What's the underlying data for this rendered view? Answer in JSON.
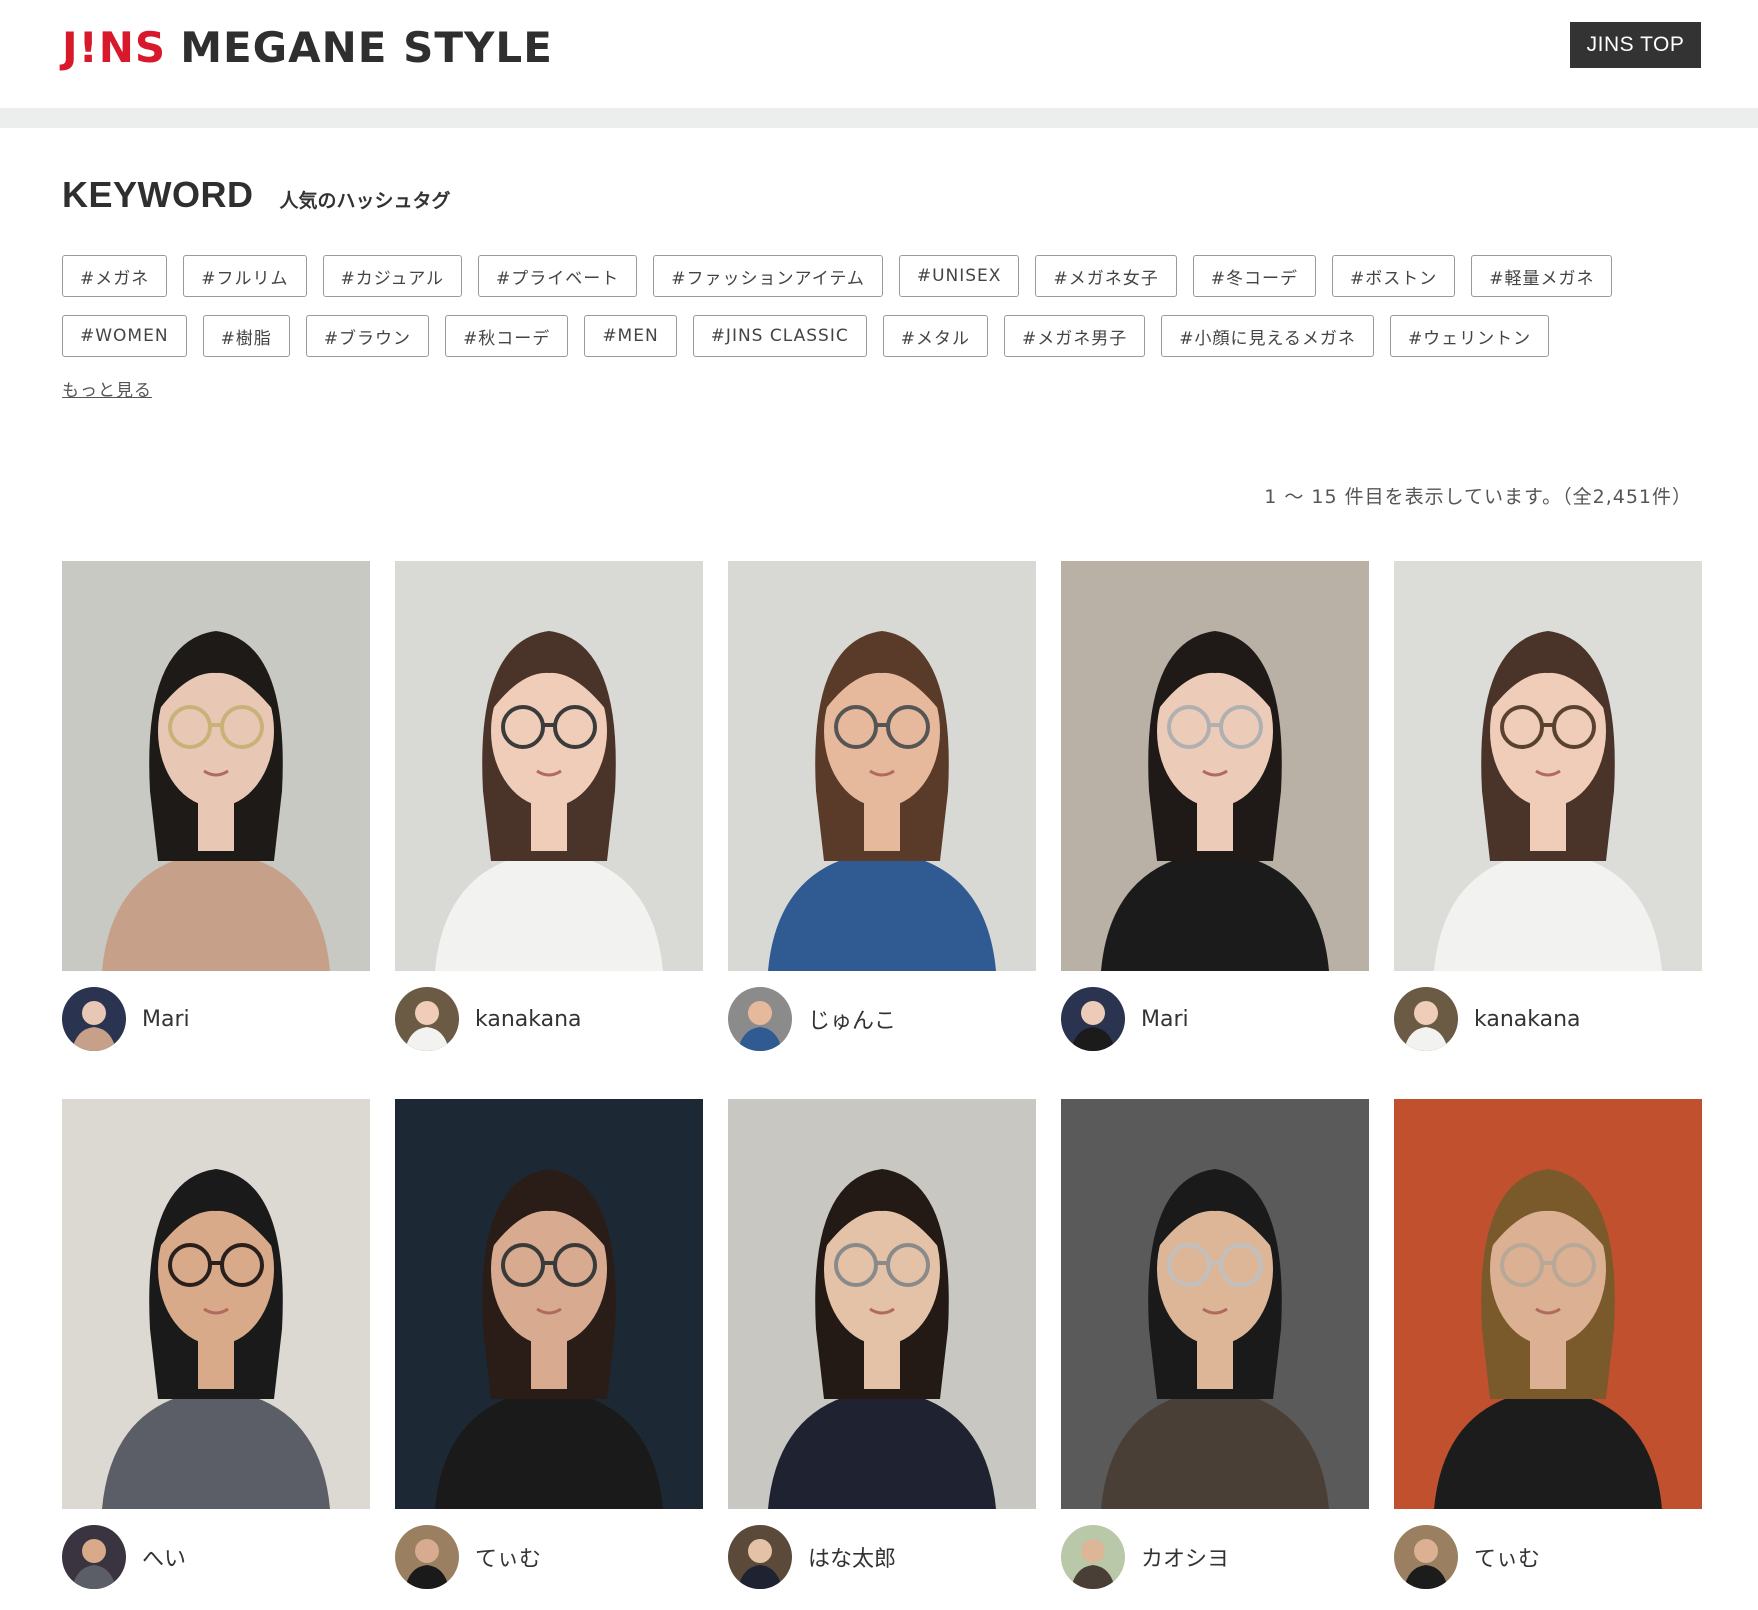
{
  "header": {
    "logo_brand": "J!NS",
    "logo_sub": "MEGANE STYLE",
    "top_button": "JINS TOP"
  },
  "keyword": {
    "title_en": "KEYWORD",
    "title_jp": "人気のハッシュタグ",
    "tags_row1": [
      "#メガネ",
      "#フルリム",
      "#カジュアル",
      "#プライベート",
      "#ファッションアイテム",
      "#UNISEX",
      "#メガネ女子",
      "#冬コーデ",
      "#ボストン",
      "#軽量メガネ"
    ],
    "tags_row2": [
      "#WOMEN",
      "#樹脂",
      "#ブラウン",
      "#秋コーデ",
      "#MEN",
      "#JINS CLASSIC",
      "#メタル",
      "#メガネ男子",
      "#小顔に見えるメガネ",
      "#ウェリントン"
    ],
    "more_link": "もっと見る"
  },
  "results": {
    "count_text": "1 〜 15 件目を表示しています。（全2,451件）"
  },
  "posts": [
    {
      "user": "Mari",
      "bg": "#c9c9c4",
      "skin": "#e8c8b4",
      "hair": "#1e1a18",
      "cloth": "#c7a08a",
      "avatar_bg": "#2a3350",
      "glasses": "#c9b27a"
    },
    {
      "user": "kanakana",
      "bg": "#d9d9d6",
      "skin": "#efcdb9",
      "hair": "#4a3328",
      "cloth": "#f2f2f0",
      "avatar_bg": "#6b5a44",
      "glasses": "#3b3b3b"
    },
    {
      "user": "じゅんこ",
      "bg": "#d8d8d5",
      "skin": "#e6b99c",
      "hair": "#5a3a28",
      "cloth": "#2f5a92",
      "avatar_bg": "#8b8b8b",
      "glasses": "#555555"
    },
    {
      "user": "Mari",
      "bg": "#b9b1a6",
      "skin": "#ecccb8",
      "hair": "#1f1a17",
      "cloth": "#1b1b1b",
      "avatar_bg": "#2a3350",
      "glasses": "#b0b0b0"
    },
    {
      "user": "kanakana",
      "bg": "#dcdcd9",
      "skin": "#efcdb9",
      "hair": "#4a3328",
      "cloth": "#f2f2f0",
      "avatar_bg": "#6b5a44",
      "glasses": "#5a4230"
    },
    {
      "user": "へい",
      "bg": "#dcd8d2",
      "skin": "#d9aa8a",
      "hair": "#1a1a1a",
      "cloth": "#5b5e66",
      "avatar_bg": "#3a3340",
      "glasses": "#2a1f1a"
    },
    {
      "user": "てぃむ",
      "bg": "#1c2833",
      "skin": "#d8ab90",
      "hair": "#2a1d18",
      "cloth": "#1a1a1a",
      "avatar_bg": "#9a8060",
      "glasses": "#3a3a3a"
    },
    {
      "user": "はな太郎",
      "bg": "#c9c7c2",
      "skin": "#e3c2a8",
      "hair": "#231a15",
      "cloth": "#1f2230",
      "avatar_bg": "#5b4a3a",
      "glasses": "#8a8a8a"
    },
    {
      "user": "カオシヨ",
      "bg": "#5a5a5a",
      "skin": "#ddb698",
      "hair": "#1a1a1a",
      "cloth": "#4a3f36",
      "avatar_bg": "#b8c8a8",
      "glasses": "#c0c0c0"
    },
    {
      "user": "てぃむ",
      "bg": "#c1502f",
      "skin": "#dcb092",
      "hair": "#7a5a2a",
      "cloth": "#1c1c1c",
      "avatar_bg": "#9a8060",
      "glasses": "#b8a898"
    }
  ],
  "colors": {
    "brand_red": "#d7192b",
    "button_dark": "#333333",
    "band_gray": "#eceeee"
  }
}
